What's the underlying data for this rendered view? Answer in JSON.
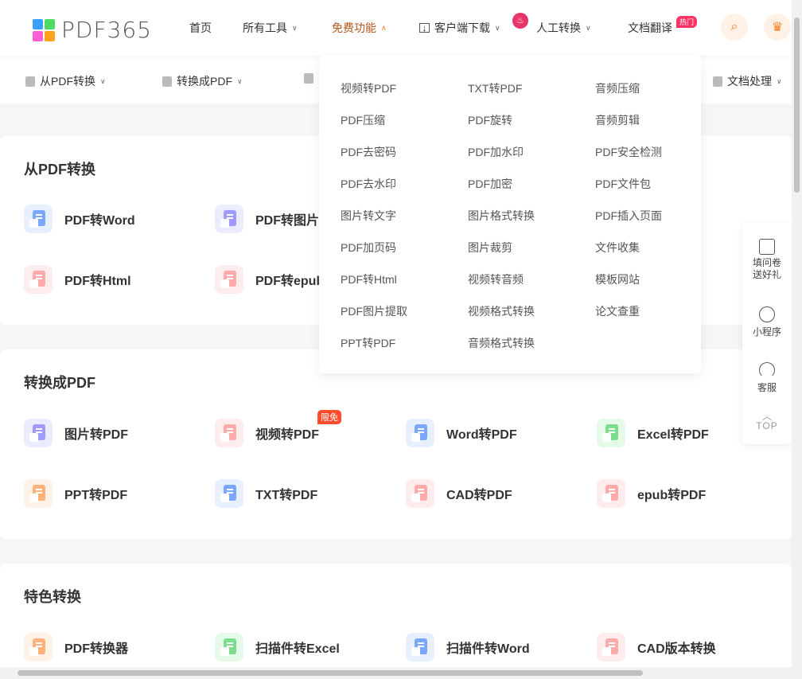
{
  "header": {
    "logo": "PDF365",
    "nav": [
      {
        "label": "首页"
      },
      {
        "label": "所有工具"
      },
      {
        "label": "免费功能"
      },
      {
        "label": "客户端下载"
      },
      {
        "label": "人工转换"
      },
      {
        "label": "文档翻译"
      }
    ],
    "hot_badge": "热门",
    "accent": "#ff7a1a"
  },
  "subnav": [
    {
      "label": "从PDF转换"
    },
    {
      "label": "转换成PDF"
    },
    {
      "label": "文档处理"
    }
  ],
  "dropdown": {
    "columns": [
      [
        "视频转PDF",
        "PDF压缩",
        "PDF去密码",
        "PDF去水印",
        "图片转文字",
        "PDF加页码",
        "PDF转Html",
        "PDF图片提取",
        "PPT转PDF"
      ],
      [
        "TXT转PDF",
        "PDF旋转",
        "PDF加水印",
        "PDF加密",
        "图片格式转换",
        "图片裁剪",
        "视频转音频",
        "视频格式转换",
        "音频格式转换"
      ],
      [
        "音频压缩",
        "音频剪辑",
        "PDF安全检测",
        "PDF文件包",
        "PDF插入页面",
        "文件收集",
        "模板网站",
        "论文查重"
      ]
    ]
  },
  "sections": [
    {
      "title": "从PDF转换",
      "items": [
        {
          "label": "PDF转Word",
          "color": "blue"
        },
        {
          "label": "PDF转图片",
          "color": "purple"
        },
        {
          "label": "PDF转Html",
          "color": "red"
        },
        {
          "label": "PDF转epub",
          "color": "red"
        }
      ]
    },
    {
      "title": "转换成PDF",
      "badge": "限免",
      "items": [
        {
          "label": "图片转PDF",
          "color": "purple"
        },
        {
          "label": "视频转PDF",
          "color": "red"
        },
        {
          "label": "Word转PDF",
          "color": "blue"
        },
        {
          "label": "Excel转PDF",
          "color": "green"
        },
        {
          "label": "PPT转PDF",
          "color": "orange"
        },
        {
          "label": "TXT转PDF",
          "color": "blue"
        },
        {
          "label": "CAD转PDF",
          "color": "red"
        },
        {
          "label": "epub转PDF",
          "color": "red"
        }
      ]
    },
    {
      "title": "特色转换",
      "items": [
        {
          "label": "PDF转换器",
          "color": "orange"
        },
        {
          "label": "扫描件转Excel",
          "color": "green"
        },
        {
          "label": "扫描件转Word",
          "color": "blue"
        },
        {
          "label": "CAD版本转换",
          "color": "red"
        }
      ]
    }
  ],
  "side": [
    {
      "label": "填问卷送好礼",
      "icon": "survey-icon"
    },
    {
      "label": "小程序",
      "icon": "mini-program-icon"
    },
    {
      "label": "客服",
      "icon": "headset-icon"
    },
    {
      "label": "TOP",
      "icon": "chevron-up-icon"
    }
  ]
}
